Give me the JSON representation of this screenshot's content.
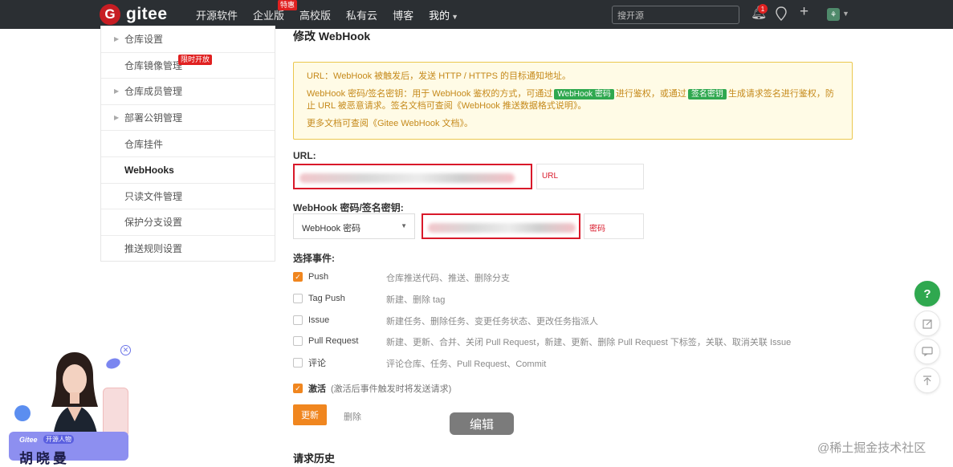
{
  "topbar": {
    "logo_letter": "G",
    "brand": "gitee",
    "nav": [
      {
        "label": "开源软件",
        "badge": ""
      },
      {
        "label": "企业版",
        "badge": "特惠"
      },
      {
        "label": "高校版",
        "badge": ""
      },
      {
        "label": "私有云",
        "badge": ""
      },
      {
        "label": "博客",
        "badge": ""
      },
      {
        "label": "我的",
        "badge": ""
      }
    ],
    "search_placeholder": "搜开源",
    "notification_count": "1",
    "icons": [
      "bell-icon",
      "location-icon",
      "plus-icon",
      "avatar-icon"
    ]
  },
  "sidebar": {
    "items": [
      {
        "label": "仓库设置",
        "arrow": true,
        "badge": ""
      },
      {
        "label": "仓库镜像管理",
        "arrow": false,
        "badge": "限时开放"
      },
      {
        "label": "仓库成员管理",
        "arrow": true,
        "badge": ""
      },
      {
        "label": "部署公钥管理",
        "arrow": true,
        "badge": ""
      },
      {
        "label": "仓库挂件",
        "arrow": false,
        "badge": ""
      },
      {
        "label": "WebHooks",
        "arrow": false,
        "badge": "",
        "active": true
      },
      {
        "label": "只读文件管理",
        "arrow": false,
        "badge": ""
      },
      {
        "label": "保护分支设置",
        "arrow": false,
        "badge": ""
      },
      {
        "label": "推送规则设置",
        "arrow": false,
        "badge": ""
      }
    ]
  },
  "main": {
    "title": "修改 WebHook",
    "notice": {
      "line1": "URL：WebHook 被触发后，发送 HTTP / HTTPS 的目标通知地址。",
      "line2_a": "WebHook 密码/签名密钥：用于 WebHook 鉴权的方式，可通过",
      "line2_tag1": "WebHook 密码",
      "line2_b": "进行鉴权，或通过",
      "line2_tag2": "签名密钥",
      "line2_c": "生成请求签名进行鉴权，防止 URL 被恶意请求。签名文档可查阅《WebHook 推送数据格式说明》。",
      "line3": "更多文档可查阅《Gitee WebHook 文档》。"
    },
    "url_label": "URL:",
    "url_annotation": "URL",
    "secret_label": "WebHook 密码/签名密钥:",
    "secret_type": "WebHook 密码",
    "secret_annotation": "密码",
    "events_label": "选择事件:",
    "events": [
      {
        "name": "Push",
        "desc": "仓库推送代码、推送、删除分支",
        "checked": true
      },
      {
        "name": "Tag Push",
        "desc": "新建、删除 tag",
        "checked": false
      },
      {
        "name": "Issue",
        "desc": "新建任务、删除任务、变更任务状态、更改任务指派人",
        "checked": false
      },
      {
        "name": "Pull Request",
        "desc": "新建、更新、合并、关闭 Pull Request，新建、更新、删除 Pull Request 下标签，关联、取消关联 Issue",
        "checked": false
      },
      {
        "name": "评论",
        "desc": "评论仓库、任务、Pull Request、Commit",
        "checked": false
      }
    ],
    "activate_label": "激活",
    "activate_hint": "(激活后事件触发时将发送请求)",
    "activate_checked": true,
    "update_button": "更新",
    "delete_button": "删除",
    "history_title": "请求历史"
  },
  "overlay": {
    "edit_label": "编辑",
    "float_buttons": [
      "help-icon",
      "edit-icon",
      "comment-icon",
      "back-to-top-icon"
    ],
    "help_glyph": "?",
    "watermark": "@稀土掘金技术社区"
  },
  "promo": {
    "brand": "Gitee",
    "tag": "开源人物",
    "name": "胡晓曼"
  },
  "colors": {
    "topbar": "#2b2f33",
    "brand_red": "#c71d23",
    "accent_orange": "#f0861f",
    "notice_bg": "#fffbe6",
    "notice_text": "#c5891a",
    "annotation_red": "#d9192a",
    "help_green": "#2fa84f"
  }
}
